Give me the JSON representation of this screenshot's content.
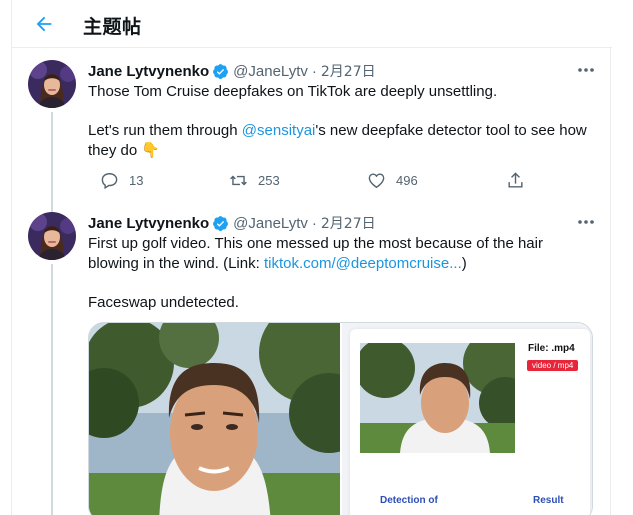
{
  "header": {
    "back_icon": "arrow-left-icon",
    "title": "主题帖"
  },
  "tweets": [
    {
      "author": {
        "name": "Jane Lytvynenko",
        "handle": "@JaneLytv",
        "verified": true,
        "verified_icon": "verified-badge-icon"
      },
      "date": "2月27日",
      "separator": "·",
      "text": {
        "line1": "Those Tom Cruise deepfakes on TikTok are deeply unsettling.",
        "part2_before": "Let's run them through ",
        "mention": "@sensityai",
        "part2_after": "'s new deepfake detector tool to see how they do",
        "emoji": "👇"
      },
      "actions": {
        "replies": "13",
        "retweets": "253",
        "likes": "496"
      }
    },
    {
      "author": {
        "name": "Jane Lytvynenko",
        "handle": "@JaneLytv",
        "verified": true,
        "verified_icon": "verified-badge-icon"
      },
      "date": "2月27日",
      "separator": "·",
      "text": {
        "line1_before": "First up golf video. This one messed up the most because of the hair blowing in the wind. (Link: ",
        "link": "tiktok.com/@deeptomcruise...",
        "line1_after": ")",
        "line2": "Faceswap undetected."
      },
      "media": {
        "file_label": "File: .mp4",
        "file_badge": "video / mp4",
        "col1_heading": "Detection of",
        "col2_heading": "Result"
      }
    }
  ],
  "colors": {
    "accent": "#1da1f2",
    "link": "#1b95e0",
    "muted": "#536471",
    "badge_red": "#e8263a",
    "panel_heading": "#2c4fb5"
  }
}
